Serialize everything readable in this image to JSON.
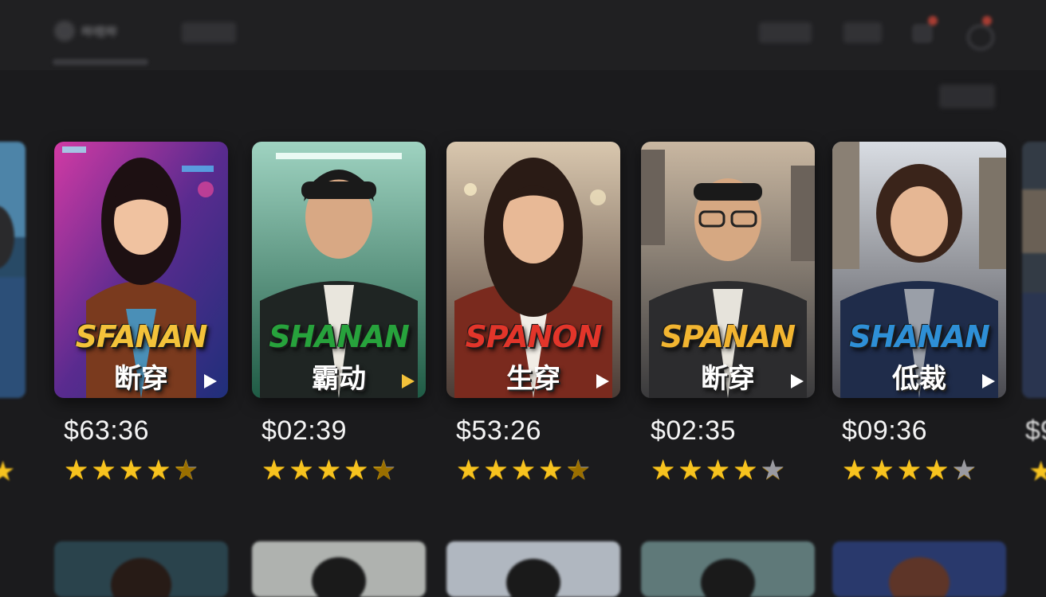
{
  "header": {
    "logo_text": "哔哩哔",
    "nav_pill": "",
    "search_pill": "",
    "menu_pill": "",
    "sort_pill": ""
  },
  "cards": [
    {
      "title": "SFANAN",
      "subtitle": "断穿",
      "price": "$63:36",
      "rating": 4.5,
      "title_color": "#f3c23a",
      "bg": "#7a2c8f"
    },
    {
      "title": "SHANAN",
      "subtitle": "霸动",
      "price": "$02:39",
      "rating": 4.5,
      "title_color": "#27a23c",
      "bg": "#2f6d57"
    },
    {
      "title": "SPANON",
      "subtitle": "生穿",
      "price": "$53:26",
      "rating": 4.5,
      "title_color": "#e2352a",
      "bg": "#8b6b5c"
    },
    {
      "title": "SPANAN",
      "subtitle": "断穿",
      "price": "$02:35",
      "rating": 4.0,
      "title_color": "#f2b531",
      "bg": "#6d6a68"
    },
    {
      "title": "SHANAN",
      "subtitle": "低裁",
      "price": "$09:36",
      "rating": 4.0,
      "title_color": "#2e8fd6",
      "bg": "#7b7a7f"
    }
  ],
  "edge_left": {
    "price": "",
    "stars": "★"
  },
  "edge_right": {
    "price": "$9",
    "stars": "★"
  }
}
